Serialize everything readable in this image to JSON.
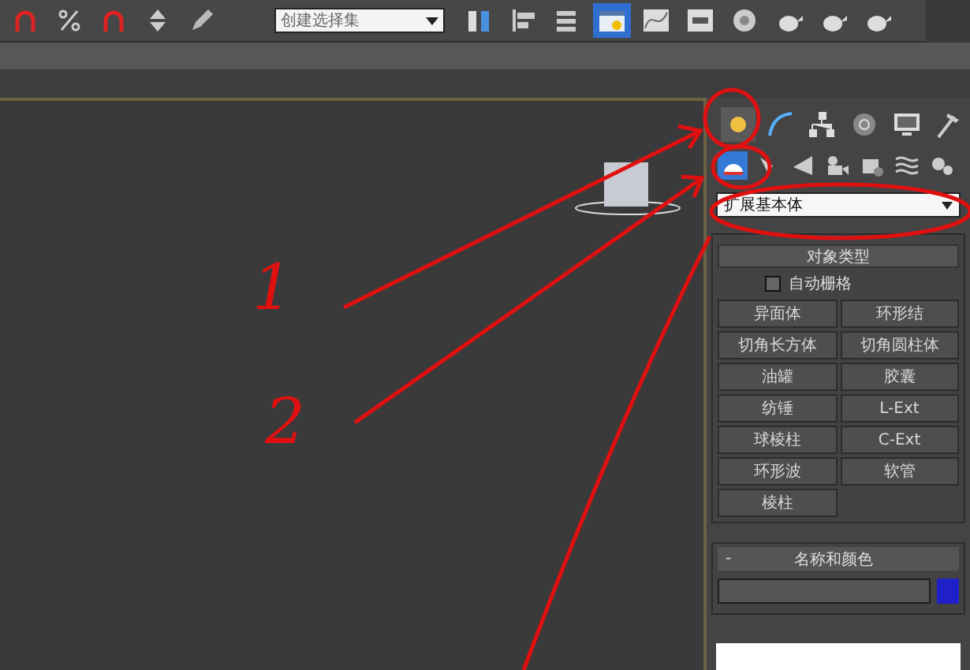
{
  "toolbar": {
    "dropdown": "创建选择集",
    "buttons": [
      {
        "kind": "snap",
        "selected": false
      },
      {
        "kind": "percent",
        "selected": false
      },
      {
        "kind": "snap",
        "selected": false
      },
      {
        "kind": "spinner",
        "selected": false
      },
      {
        "kind": "pencil",
        "selected": false
      }
    ],
    "tools": [
      {
        "kind": "mirror",
        "selected": false
      },
      {
        "kind": "align",
        "selected": false
      },
      {
        "kind": "layers",
        "selected": false
      },
      {
        "kind": "window",
        "selected": true
      },
      {
        "kind": "curve",
        "selected": false
      },
      {
        "kind": "schematic",
        "selected": false
      },
      {
        "kind": "sphere",
        "selected": false
      },
      {
        "kind": "teapot",
        "selected": false
      },
      {
        "kind": "teapot",
        "selected": false
      },
      {
        "kind": "teapot",
        "selected": false
      }
    ]
  },
  "command_tabs": [
    {
      "kind": "sun",
      "selected": true
    },
    {
      "kind": "arc",
      "selected": false
    },
    {
      "kind": "tree",
      "selected": false
    },
    {
      "kind": "clock",
      "selected": false
    },
    {
      "kind": "monitor",
      "selected": false
    },
    {
      "kind": "hammer",
      "selected": false
    }
  ],
  "category_tabs": [
    {
      "kind": "geometry",
      "selected": true
    },
    {
      "kind": "shape",
      "selected": false
    },
    {
      "kind": "light",
      "selected": false
    },
    {
      "kind": "camera",
      "selected": false
    },
    {
      "kind": "helper",
      "selected": false
    },
    {
      "kind": "wave",
      "selected": false
    },
    {
      "kind": "system",
      "selected": false
    }
  ],
  "type_dropdown": {
    "value": "扩展基本体"
  },
  "object_type": {
    "title": "对象类型",
    "autogrid": {
      "label": "自动栅格",
      "checked": false
    },
    "buttons": [
      "异面体",
      "环形结",
      "切角长方体",
      "切角圆柱体",
      "油罐",
      "胶囊",
      "纺锤",
      "L-Ext",
      "球棱柱",
      "C-Ext",
      "环形波",
      "软管",
      "棱柱"
    ]
  },
  "name_color": {
    "collapse": "-",
    "title": "名称和颜色"
  },
  "annotations": [
    {
      "label": "1"
    },
    {
      "label": "2"
    }
  ]
}
